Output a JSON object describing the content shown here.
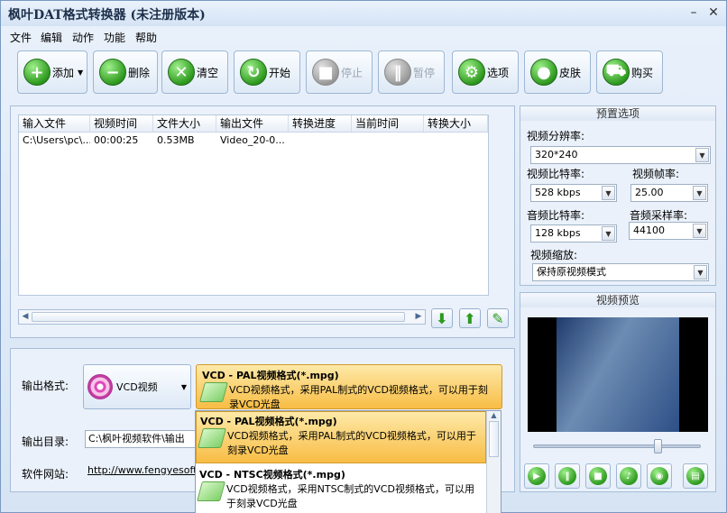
{
  "window": {
    "title": "枫叶DAT格式转换器  (未注册版本)",
    "minimize": "–",
    "maximize": "□",
    "close": "✕"
  },
  "menu": [
    "文件",
    "编辑",
    "动作",
    "功能",
    "帮助"
  ],
  "toolbar": {
    "add": "添加",
    "delete": "删除",
    "clear": "清空",
    "start": "开始",
    "stop": "停止",
    "pause": "暂停",
    "options": "选项",
    "skin": "皮肤",
    "buy": "购买"
  },
  "file_list": {
    "columns": [
      "输入文件",
      "视频时间",
      "文件大小",
      "输出文件",
      "转换进度",
      "当前时间",
      "转换大小"
    ],
    "rows": [
      [
        "C:\\Users\\pc\\...",
        "00:00:25",
        "0.53MB",
        "Video_20-0...",
        "",
        "",
        ""
      ]
    ]
  },
  "output": {
    "format_label": "输出格式:",
    "format_type": "VCD视频",
    "selected_title": "VCD - PAL视频格式(*.mpg)",
    "selected_desc": "VCD视频格式，采用PAL制式的VCD视频格式，可以用于刻录VCD光盘",
    "dir_label": "输出目录:",
    "dir_value": "C:\\枫叶视频软件\\输出",
    "site_label": "软件网站:",
    "site_url": "http://www.fengyesoft.c"
  },
  "dropdown": [
    {
      "title": "VCD - PAL视频格式(*.mpg)",
      "desc": "VCD视频格式，采用PAL制式的VCD视频格式，可以用于刻录VCD光盘"
    },
    {
      "title": "VCD - NTSC视频格式(*.mpg)",
      "desc": "VCD视频格式，采用NTSC制式的VCD视频格式，可以用于刻录VCD光盘"
    }
  ],
  "preset": {
    "header": "预置选项",
    "resolution_label": "视频分辨率:",
    "resolution": "320*240",
    "vbitrate_label": "视频比特率:",
    "vbitrate": "528 kbps",
    "fps_label": "视频帧率:",
    "fps": "25.00",
    "abitrate_label": "音频比特率:",
    "abitrate": "128 kbps",
    "asample_label": "音频采样率:",
    "asample": "44100",
    "scale_label": "视频缩放:",
    "scale": "保持原视频模式"
  },
  "preview": {
    "header": "视频预览"
  }
}
